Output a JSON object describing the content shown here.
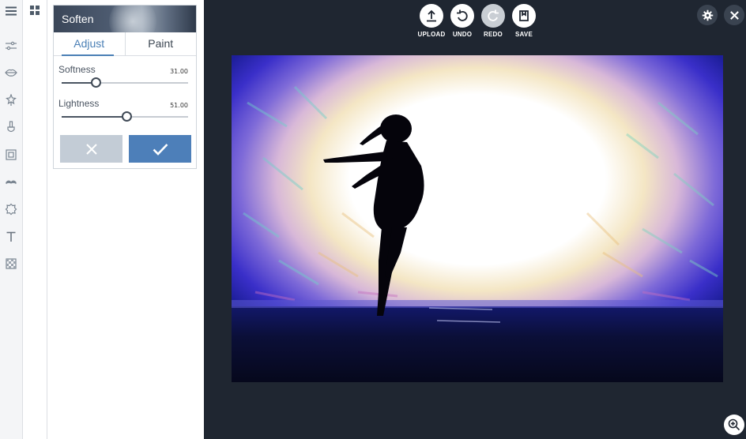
{
  "rail": {
    "icons": [
      "menu-icon",
      "sliders-icon",
      "lips-icon",
      "magic-wand-icon",
      "brush-icon",
      "frame-icon",
      "mustache-icon",
      "sticker-icon",
      "text-icon",
      "texture-icon"
    ]
  },
  "panel": {
    "title": "Soften",
    "tabs": [
      {
        "label": "Adjust",
        "active": true
      },
      {
        "label": "Paint",
        "active": false
      }
    ],
    "sliders": [
      {
        "label": "Softness",
        "value_text": "31.00",
        "fraction": 0.27
      },
      {
        "label": "Lightness",
        "value_text": "51.00",
        "fraction": 0.51
      }
    ],
    "cancel_icon": "x-icon",
    "apply_icon": "checkmark-icon"
  },
  "toolbar": {
    "upload": "UPLOAD",
    "undo": "UNDO",
    "redo": "REDO",
    "save": "SAVE"
  },
  "colors": {
    "accent": "#4a7fb5",
    "canvas_bg": "#1f2631",
    "apply_button": "#4d7fb9",
    "cancel_button": "#c3ccd6"
  }
}
